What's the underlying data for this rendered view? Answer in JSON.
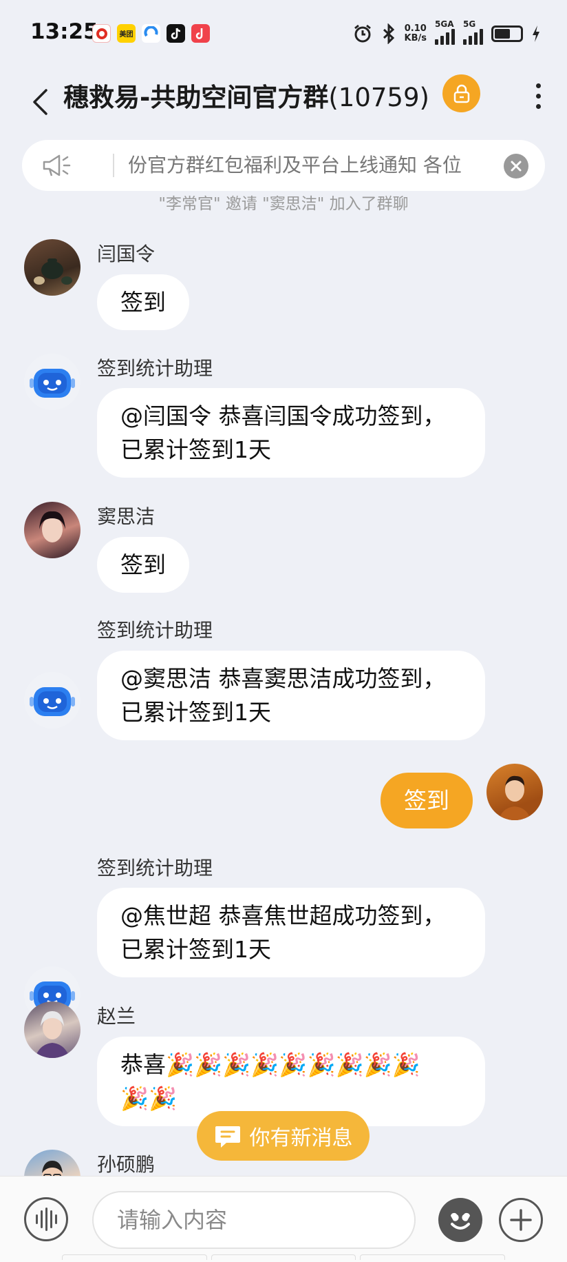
{
  "status_bar": {
    "time": "13:25",
    "app_icons": [
      "pinduoduo-icon",
      "meituan-icon",
      "browser-icon",
      "douyin-icon",
      "douyin-lite-icon"
    ],
    "meituan_label": "美团",
    "net_speed_value": "0.10",
    "net_speed_unit": "KB/s",
    "sim1_label": "5GA",
    "sim2_label": "5G",
    "battery_level": 0.55
  },
  "header": {
    "group_name": "穗救易-共助空间官方群",
    "member_count": "(10759)"
  },
  "announcement": {
    "text": "份官方群红包福利及平台上线通知  各位"
  },
  "system_note": "\"李常官\" 邀请 \"窦思洁\" 加入了群聊",
  "messages": [
    {
      "sender": "闫国令",
      "text": "签到"
    },
    {
      "sender": "签到统计助理",
      "line1": "@闫国令 恭喜闫国令成功签到，",
      "line2": "已累计签到1天"
    },
    {
      "sender": "窦思洁",
      "text": "签到"
    },
    {
      "sender": "签到统计助理",
      "line1": "@窦思洁 恭喜窦思洁成功签到，",
      "line2": "已累计签到1天"
    },
    {
      "text": "签到"
    },
    {
      "sender": "签到统计助理",
      "line1": "@焦世超 恭喜焦世超成功签到，",
      "line2": "已累计签到1天"
    },
    {
      "sender": "赵兰",
      "line1": "恭喜🎉🎉🎉🎉🎉🎉🎉🎉🎉",
      "line2": "🎉🎉"
    },
    {
      "sender": "孙硕鹏"
    }
  ],
  "new_message_pill": "你有新消息",
  "input": {
    "placeholder": "请输入内容"
  },
  "colors": {
    "accent": "#f5a623",
    "background": "#eef0f6",
    "bubble": "#ffffff"
  }
}
